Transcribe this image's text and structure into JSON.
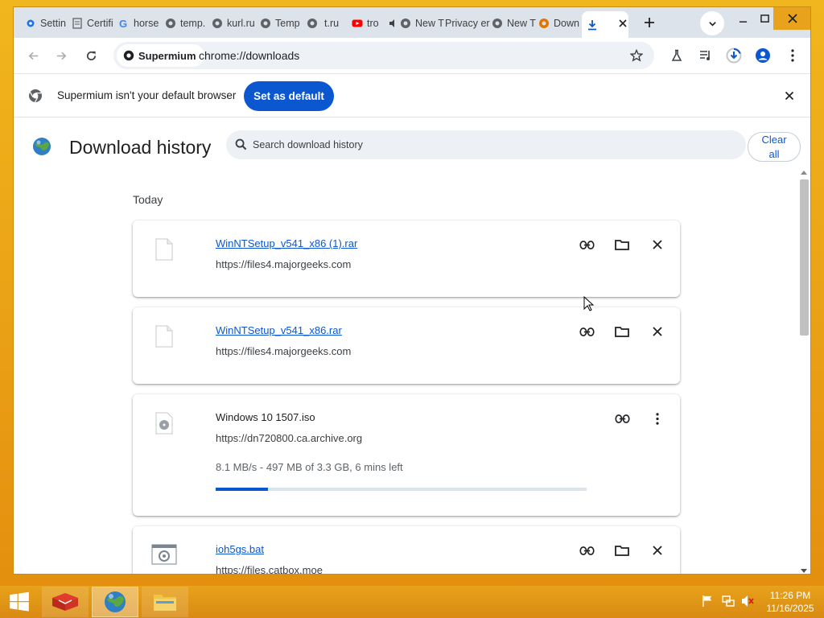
{
  "browser": {
    "tabs": [
      {
        "label": "Settin",
        "icon": "gear-icon"
      },
      {
        "label": "Certifi",
        "icon": "document-icon"
      },
      {
        "label": "horse",
        "icon": "google-icon"
      },
      {
        "label": "temp.",
        "icon": "globe-icon"
      },
      {
        "label": "kurl.ru",
        "icon": "globe-icon"
      },
      {
        "label": "Temp",
        "icon": "globe-icon"
      },
      {
        "label": "t.ru",
        "icon": "globe-icon"
      },
      {
        "label": "tro",
        "icon": "youtube-icon"
      },
      {
        "label": "New T",
        "icon": "globe-icon"
      },
      {
        "label": "Privacy err",
        "icon": "none"
      },
      {
        "label": "New T",
        "icon": "globe-icon"
      },
      {
        "label": "Down",
        "icon": "download-icon"
      }
    ],
    "address": {
      "site_chip": "Supermium",
      "url": "chrome://downloads"
    },
    "infobar": {
      "message": "Supermium isn't your default browser",
      "button": "Set as default"
    }
  },
  "downloads_page": {
    "title": "Download history",
    "search_placeholder": "Search download history",
    "clear_all": "Clear all",
    "section": "Today",
    "items": [
      {
        "name": "WinNTSetup_v541_x86 (1).rar",
        "url": "https://files4.majorgeeks.com",
        "state": "complete"
      },
      {
        "name": "WinNTSetup_v541_x86.rar",
        "url": "https://files4.majorgeeks.com",
        "state": "complete"
      },
      {
        "name": "Windows 10 1507.iso",
        "url": "https://dn720800.ca.archive.org",
        "status": "8.1 MB/s - 497 MB of 3.3 GB, 6 mins left",
        "progress_fraction": 0.14,
        "state": "in-progress"
      },
      {
        "name": "ioh5gs.bat",
        "url": "https://files.catbox.moe",
        "state": "complete"
      }
    ]
  },
  "taskbar": {
    "time": "11:26 PM",
    "date": "11/16/2025",
    "apps": [
      "red-box-app-icon",
      "browser-globe-icon",
      "file-explorer-icon"
    ]
  },
  "colors": {
    "accent": "#0b57d0",
    "desktop": "#eaa319",
    "tabstrip": "#dde3ea"
  }
}
